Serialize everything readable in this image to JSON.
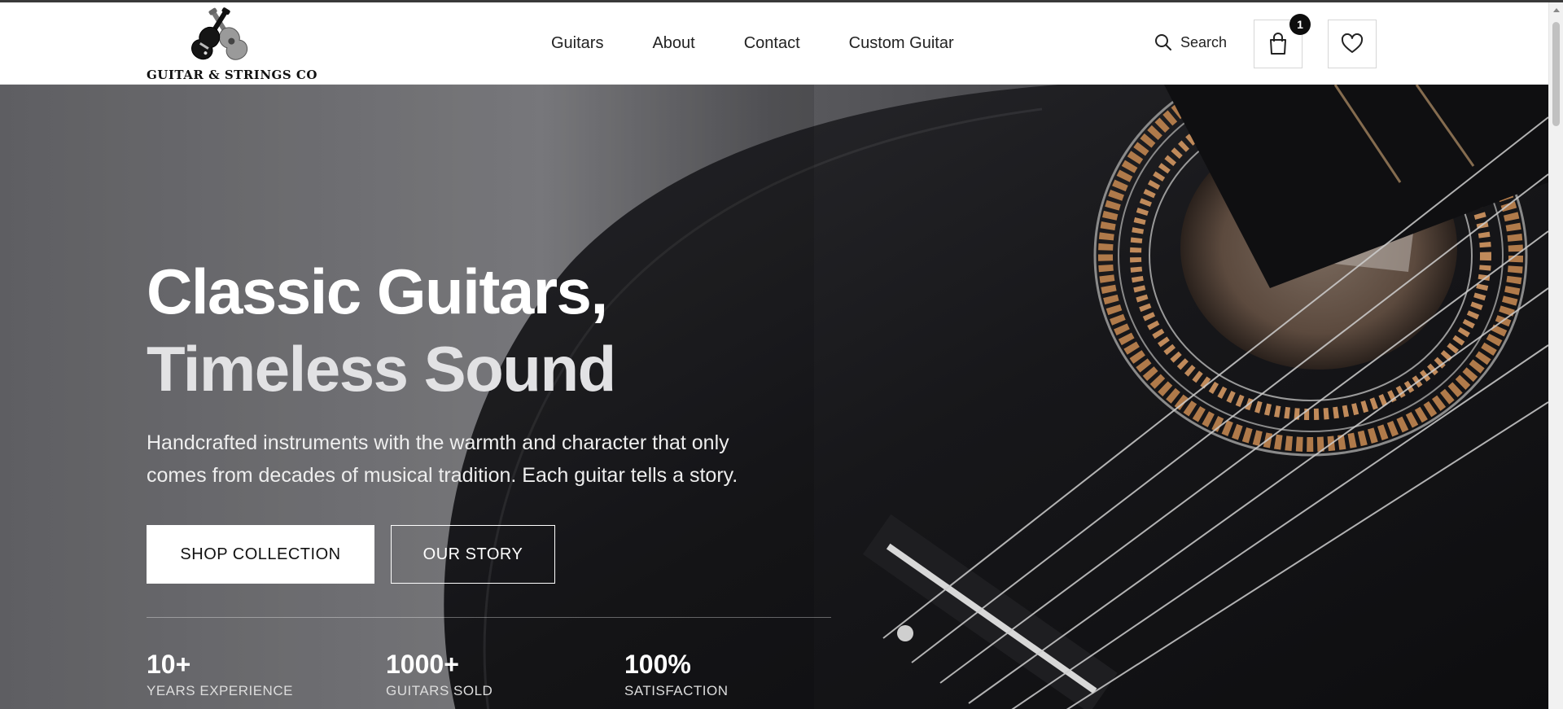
{
  "brand": {
    "logo_text": "GUITAR & STRINGS CO"
  },
  "nav": {
    "items": [
      {
        "label": "Guitars"
      },
      {
        "label": "About"
      },
      {
        "label": "Contact"
      },
      {
        "label": "Custom Guitar"
      }
    ]
  },
  "header_actions": {
    "search_label": "Search",
    "search_icon": "search-icon",
    "cart_icon": "shopping-bag-icon",
    "cart_count": "1",
    "wishlist_icon": "heart-icon"
  },
  "hero": {
    "title_line1": "Classic Guitars,",
    "title_line2": "Timeless Sound",
    "subtitle_line1": "Handcrafted instruments with the warmth and character that only",
    "subtitle_line2": "comes from decades of musical tradition. Each guitar tells a story.",
    "primary_button": "SHOP COLLECTION",
    "secondary_button": "OUR STORY",
    "stats": [
      {
        "value": "10+",
        "label": "YEARS EXPERIENCE"
      },
      {
        "value": "1000+",
        "label": "GUITARS SOLD"
      },
      {
        "value": "100%",
        "label": "SATISFACTION"
      }
    ]
  },
  "colors": {
    "header_bg": "#ffffff",
    "hero_dark": "#121214",
    "accent_text": "#ffffff",
    "badge_bg": "#0d0d0d"
  }
}
